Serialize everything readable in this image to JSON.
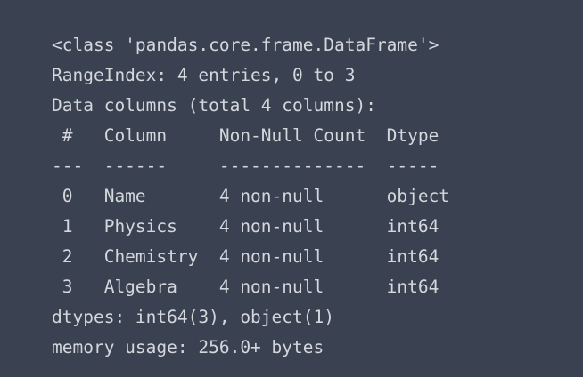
{
  "output": {
    "class_line": "<class 'pandas.core.frame.DataFrame'>",
    "range_index": "RangeIndex: 4 entries, 0 to 3",
    "data_columns": "Data columns (total 4 columns):",
    "header": " #   Column     Non-Null Count  Dtype ",
    "separator": "---  ------     --------------  ----- ",
    "rows": [
      " 0   Name       4 non-null      object",
      " 1   Physics    4 non-null      int64 ",
      " 2   Chemistry  4 non-null      int64 ",
      " 3   Algebra    4 non-null      int64 "
    ],
    "dtypes": "dtypes: int64(3), object(1)",
    "memory_usage": "memory usage: 256.0+ bytes"
  },
  "colors": {
    "background": "#3a4150",
    "text": "#d4d7dc"
  }
}
